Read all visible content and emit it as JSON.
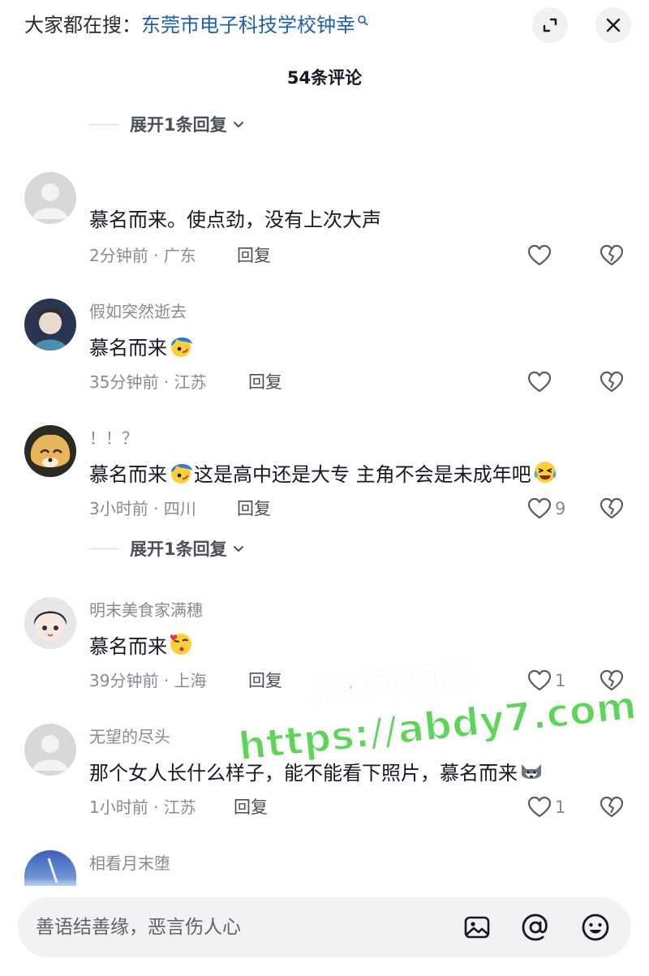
{
  "header": {
    "search_prefix": "大家都在搜：",
    "search_query": "东莞市电子科技学校钟幸",
    "icons": {
      "expand": "collapse-window-icon",
      "close": "close-icon",
      "search": "search-icon"
    }
  },
  "comment_count": "54条评论",
  "expand_replies_label": "展开1条回复",
  "comments": [
    {
      "username": "",
      "text": "慕名而来。使点劲，没有上次大声",
      "meta": "2分钟前 · 广东",
      "reply": "回复",
      "likes": "",
      "avatar": "default-avatar"
    },
    {
      "username": "假如突然逝去",
      "text": "慕名而来",
      "emoji_after": "blue-hair-emoji",
      "meta": "35分钟前 · 江苏",
      "reply": "回复",
      "likes": "",
      "avatar": "anime-girl-avatar"
    },
    {
      "username": "！！？",
      "text": "慕名而来",
      "text2": "这是高中还是大专 主角不会是未成年吧",
      "emoji_mid": "blue-hair-emoji",
      "emoji_after": "crying-laugh-emoji",
      "meta": "3小时前 · 四川",
      "reply": "回复",
      "likes": "9",
      "avatar": "shiba-dog-avatar"
    },
    {
      "username": "明末美食家满穗",
      "text": "慕名而来",
      "emoji_after": "kiss-wink-emoji",
      "meta": "39分钟前 · 上海",
      "reply": "回复",
      "likes": "1",
      "avatar": "anime-chibi-avatar"
    },
    {
      "username": "无望的尽头",
      "text": "那个女人长什么样子，能不能看下照片，慕名而来",
      "emoji_after": "husky-emoji",
      "meta": "1小时前 · 江苏",
      "reply": "回复",
      "likes": "1",
      "avatar": "default-avatar"
    },
    {
      "username": "相看月末堕",
      "avatar": "sky-avatar"
    }
  ],
  "watermark": {
    "line1": "黑料不打烊",
    "line2": "https://abdy7.com"
  },
  "input": {
    "placeholder": "善语结善缘，恶言伤人心",
    "icons": [
      "image-icon",
      "at-icon",
      "emoji-icon"
    ]
  },
  "colors": {
    "link_blue": "#1f5fa8",
    "text_primary": "#161823",
    "text_secondary": "#8a8b91",
    "watermark_green": "#5fd35a"
  }
}
